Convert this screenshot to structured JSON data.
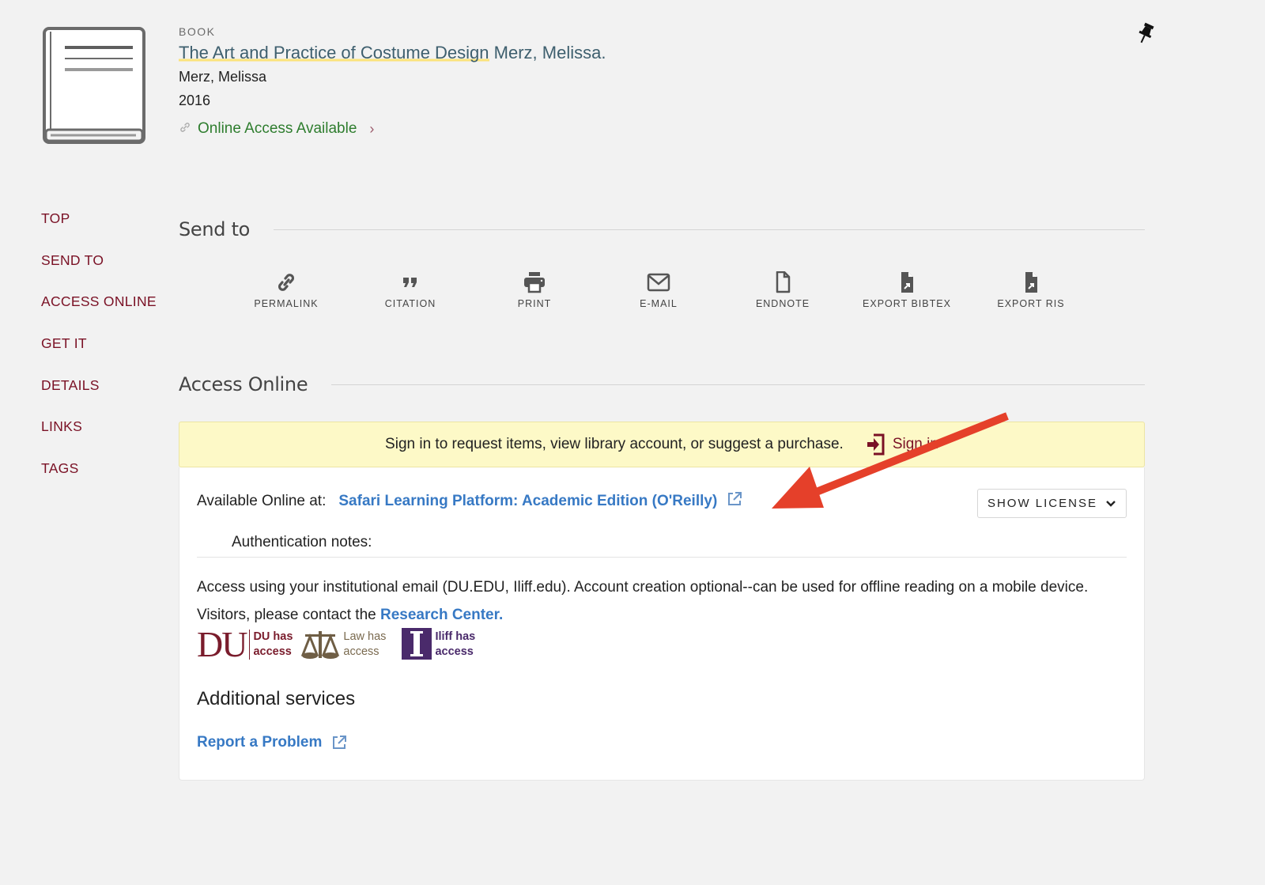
{
  "record": {
    "type": "BOOK",
    "title_main": "The Art and Practice of Costume Design",
    "title_rest": " Merz, Melissa.",
    "author": "Merz, Melissa",
    "year": "2016",
    "online_access_label": "Online Access Available"
  },
  "side_nav": {
    "items": [
      "TOP",
      "SEND TO",
      "ACCESS ONLINE",
      "GET IT",
      "DETAILS",
      "LINKS",
      "TAGS"
    ]
  },
  "send_to": {
    "heading": "Send to",
    "actions": [
      {
        "label": "PERMALINK",
        "icon": "link-icon"
      },
      {
        "label": "CITATION",
        "icon": "quote-icon"
      },
      {
        "label": "PRINT",
        "icon": "printer-icon"
      },
      {
        "label": "E-MAIL",
        "icon": "envelope-icon"
      },
      {
        "label": "ENDNOTE",
        "icon": "file-icon"
      },
      {
        "label": "EXPORT BIBTEX",
        "icon": "file-export-icon"
      },
      {
        "label": "EXPORT RIS",
        "icon": "file-export-icon"
      }
    ]
  },
  "access_online": {
    "heading": "Access Online",
    "signin_message": "Sign in to request items, view library account, or suggest a purchase.",
    "signin_label": "Sign in",
    "available_label": "Available Online at:",
    "service_name": "Safari Learning Platform: Academic Edition (O'Reilly)",
    "show_license_label": "SHOW LICENSE",
    "auth_notes_label": "Authentication notes:",
    "auth_note_text": "Access using your institutional email (DU.EDU, Iliff.edu). Account creation optional--can be used for offline reading on a mobile device. Visitors, please contact the ",
    "auth_note_link": "Research Center.",
    "logos": [
      {
        "mark": "DU",
        "caption_1": "DU has",
        "caption_2": "access",
        "color": "#7a1c2c"
      },
      {
        "mark": "scales",
        "caption_1": "Law has",
        "caption_2": "access",
        "color": "#7a6a4f"
      },
      {
        "mark": "I",
        "caption_1": "Iliff has",
        "caption_2": "access",
        "color": "#4a2a6b"
      }
    ],
    "additional_services_heading": "Additional services",
    "report_problem_label": "Report a Problem"
  },
  "colors": {
    "nav_link": "#7a1125",
    "link_blue": "#3779c4",
    "online_green": "#2e7d2e",
    "banner_yellow": "#fdf9c7",
    "annotation_red": "#e5402a"
  }
}
